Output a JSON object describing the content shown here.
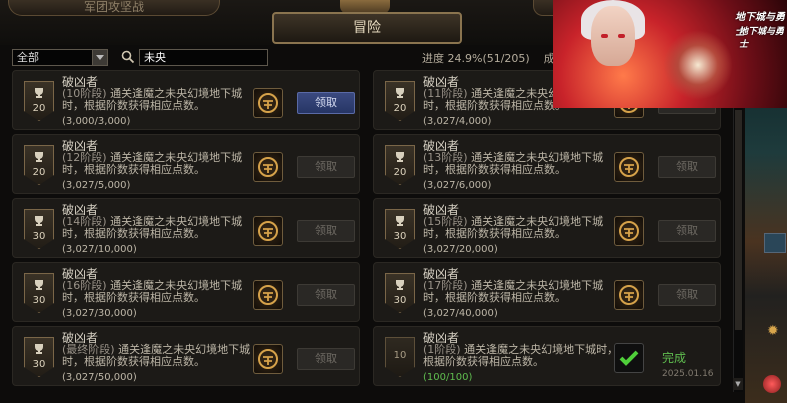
{
  "header": {
    "tab_left": "军团攻坚战",
    "tab_active": "冒险"
  },
  "filter": {
    "category": "全部",
    "search_value": "未央"
  },
  "progress": {
    "label": "进度 24.9%(51/205)",
    "trailing": "成"
  },
  "buttons": {
    "claim": "领取",
    "complete": "完成"
  },
  "ad": {
    "logo_a": "地下城与勇士",
    "logo_b": "地下城与勇士"
  },
  "achievements": [
    {
      "title": "破凶者",
      "stage": "(10阶段)",
      "desc": "通关逢魔之未央幻境地下城时，根据阶数获得相应点数。",
      "count": "(3,000/3,000)",
      "points": "20",
      "state": "claimable"
    },
    {
      "title": "破凶者",
      "stage": "(11阶段)",
      "desc": "通关逢魔之未央幻境地下城时，根据阶数获得相应点数。",
      "count": "(3,027/4,000)",
      "points": "20",
      "state": "locked"
    },
    {
      "title": "破凶者",
      "stage": "(12阶段)",
      "desc": "通关逢魔之未央幻境地下城时，根据阶数获得相应点数。",
      "count": "(3,027/5,000)",
      "points": "20",
      "state": "locked"
    },
    {
      "title": "破凶者",
      "stage": "(13阶段)",
      "desc": "通关逢魔之未央幻境地下城时，根据阶数获得相应点数。",
      "count": "(3,027/6,000)",
      "points": "20",
      "state": "locked"
    },
    {
      "title": "破凶者",
      "stage": "(14阶段)",
      "desc": "通关逢魔之未央幻境地下城时，根据阶数获得相应点数。",
      "count": "(3,027/10,000)",
      "points": "30",
      "state": "locked"
    },
    {
      "title": "破凶者",
      "stage": "(15阶段)",
      "desc": "通关逢魔之未央幻境地下城时，根据阶数获得相应点数。",
      "count": "(3,027/20,000)",
      "points": "30",
      "state": "locked"
    },
    {
      "title": "破凶者",
      "stage": "(16阶段)",
      "desc": "通关逢魔之未央幻境地下城时，根据阶数获得相应点数。",
      "count": "(3,027/30,000)",
      "points": "30",
      "state": "locked"
    },
    {
      "title": "破凶者",
      "stage": "(17阶段)",
      "desc": "通关逢魔之未央幻境地下城时，根据阶数获得相应点数。",
      "count": "(3,027/40,000)",
      "points": "30",
      "state": "locked"
    },
    {
      "title": "破凶者",
      "stage": "(最终阶段)",
      "desc": "通关逢魔之未央幻境地下城时，根据阶数获得相应点数。",
      "count": "(3,027/50,000)",
      "points": "30",
      "state": "locked"
    },
    {
      "title": "破凶者",
      "stage": "(1阶段)",
      "desc": "通关逢魔之未央幻境地下城时，根据阶数获得相应点数。",
      "count": "(100/100)",
      "points": "10",
      "state": "completed",
      "date": "2025.01.16"
    }
  ],
  "colors": {
    "claim_active": "#3b4a80",
    "complete_green": "#5fbd4f",
    "gold_border": "#8a744f"
  }
}
